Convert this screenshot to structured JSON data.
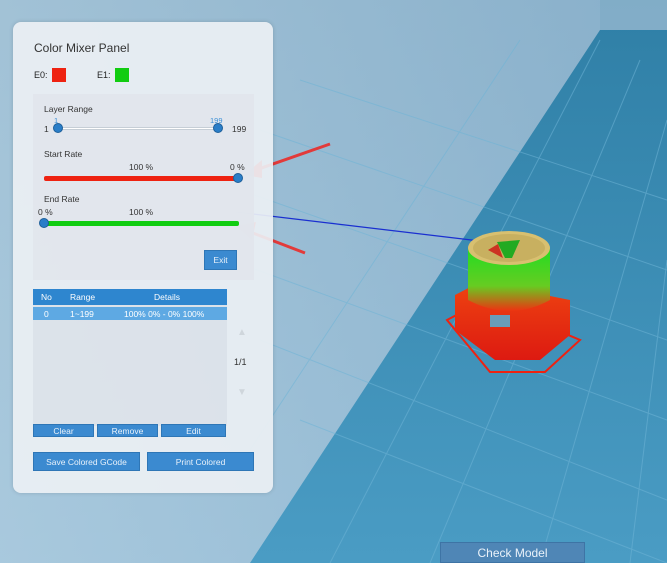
{
  "panel": {
    "title": "Color Mixer Panel",
    "extruders": [
      {
        "label": "E0:",
        "color": "#ee2211"
      },
      {
        "label": "E1:",
        "color": "#11cc11"
      }
    ]
  },
  "layer_range": {
    "label": "Layer Range",
    "min_label": "1",
    "max_label": "199",
    "from_value": "1",
    "to_value": "199"
  },
  "start_rate": {
    "label": "Start Rate",
    "left_pct": "100 %",
    "right_pct": "0 %",
    "color": "#ee2211"
  },
  "end_rate": {
    "label": "End Rate",
    "left_pct": "0 %",
    "right_pct": "100 %",
    "color": "#11cc11"
  },
  "exit_label": "Exit",
  "table": {
    "headers": [
      "No",
      "Range",
      "Details"
    ],
    "rows": [
      {
        "no": "0",
        "range": "1~199",
        "details": "100% 0% - 0% 100%"
      }
    ],
    "page": "1/1"
  },
  "actions": {
    "clear": "Clear",
    "remove": "Remove",
    "edit": "Edit",
    "save_gcode": "Save Colored GCode",
    "print_colored": "Print Colored"
  },
  "check_model": "Check Model"
}
